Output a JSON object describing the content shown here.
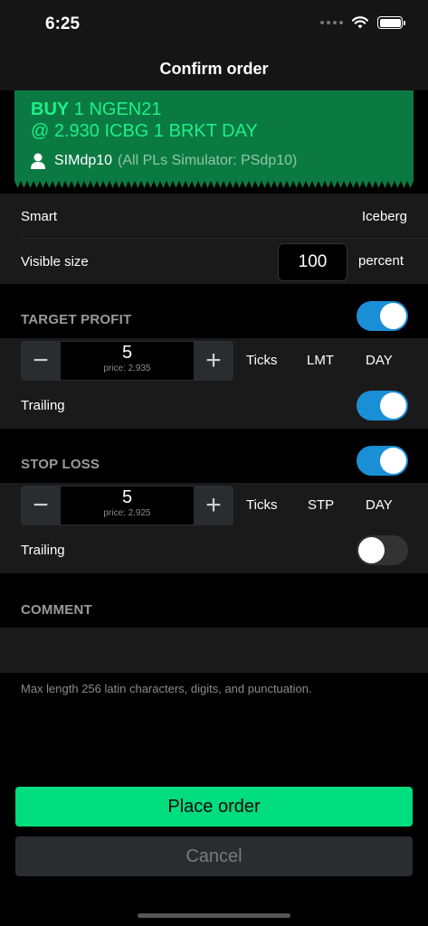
{
  "status": {
    "time": "6:25"
  },
  "nav": {
    "title": "Confirm order"
  },
  "ticket": {
    "side": "BUY",
    "line1_rest": " 1 NGEN21",
    "line2": "@ 2.930 ICBG 1 BRKT DAY",
    "account": "SIMdp10",
    "account_sub": "(All PLs Simulator: PSdp10)"
  },
  "order_type": {
    "left": "Smart",
    "right": "Iceberg"
  },
  "visible_size": {
    "label": "Visible size",
    "value": "100",
    "unit": "percent"
  },
  "target_profit": {
    "header": "TARGET PROFIT",
    "enabled": true,
    "value": "5",
    "price": "price: 2.935",
    "unit": "Ticks",
    "type": "LMT",
    "tif": "DAY",
    "trailing_label": "Trailing",
    "trailing": true
  },
  "stop_loss": {
    "header": "STOP LOSS",
    "enabled": true,
    "value": "5",
    "price": "price: 2.925",
    "unit": "Ticks",
    "type": "STP",
    "tif": "DAY",
    "trailing_label": "Trailing",
    "trailing": false
  },
  "comment": {
    "header": "COMMENT",
    "hint": "Max length 256 latin characters, digits, and punctuation."
  },
  "buttons": {
    "place": "Place order",
    "cancel": "Cancel"
  },
  "colors": {
    "ticket_bg": "#0b7a42",
    "accent_green": "#00dd7f",
    "toggle_on": "#1a8fd6"
  }
}
